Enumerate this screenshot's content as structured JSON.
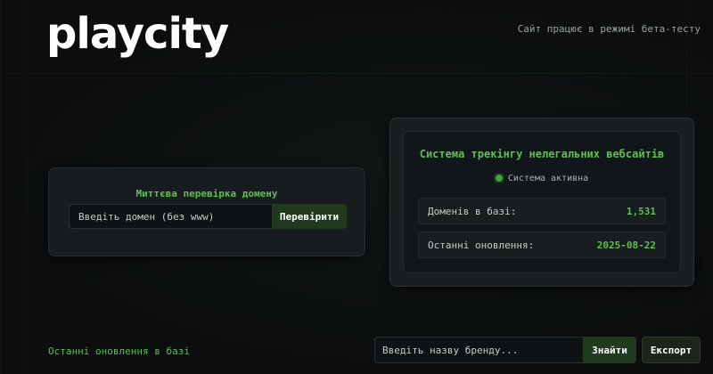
{
  "header": {
    "logo": "playcity",
    "beta_notice": "Сайт працює в режимі бета-тесту"
  },
  "quick_check": {
    "title": "Миттєва перевірка домену",
    "input_placeholder": "Введіть домен (без www)",
    "button_label": "Перевірити"
  },
  "tracker": {
    "title": "Система трекінгу нелегальних вебсайтів",
    "status_label": "Система активна",
    "stats": [
      {
        "label": "Доменів в базі:",
        "value": "1,531"
      },
      {
        "label": "Останні оновлення:",
        "value": "2025-08-22"
      }
    ]
  },
  "footer": {
    "recent_label": "Останні оновлення в базі",
    "brand_placeholder": "Введіть назву бренду...",
    "find_label": "Знайти",
    "export_label": "Експорт"
  },
  "colors": {
    "accent": "#5fbf52",
    "background": "#0b0d0f",
    "button": "#1f3a1d"
  }
}
